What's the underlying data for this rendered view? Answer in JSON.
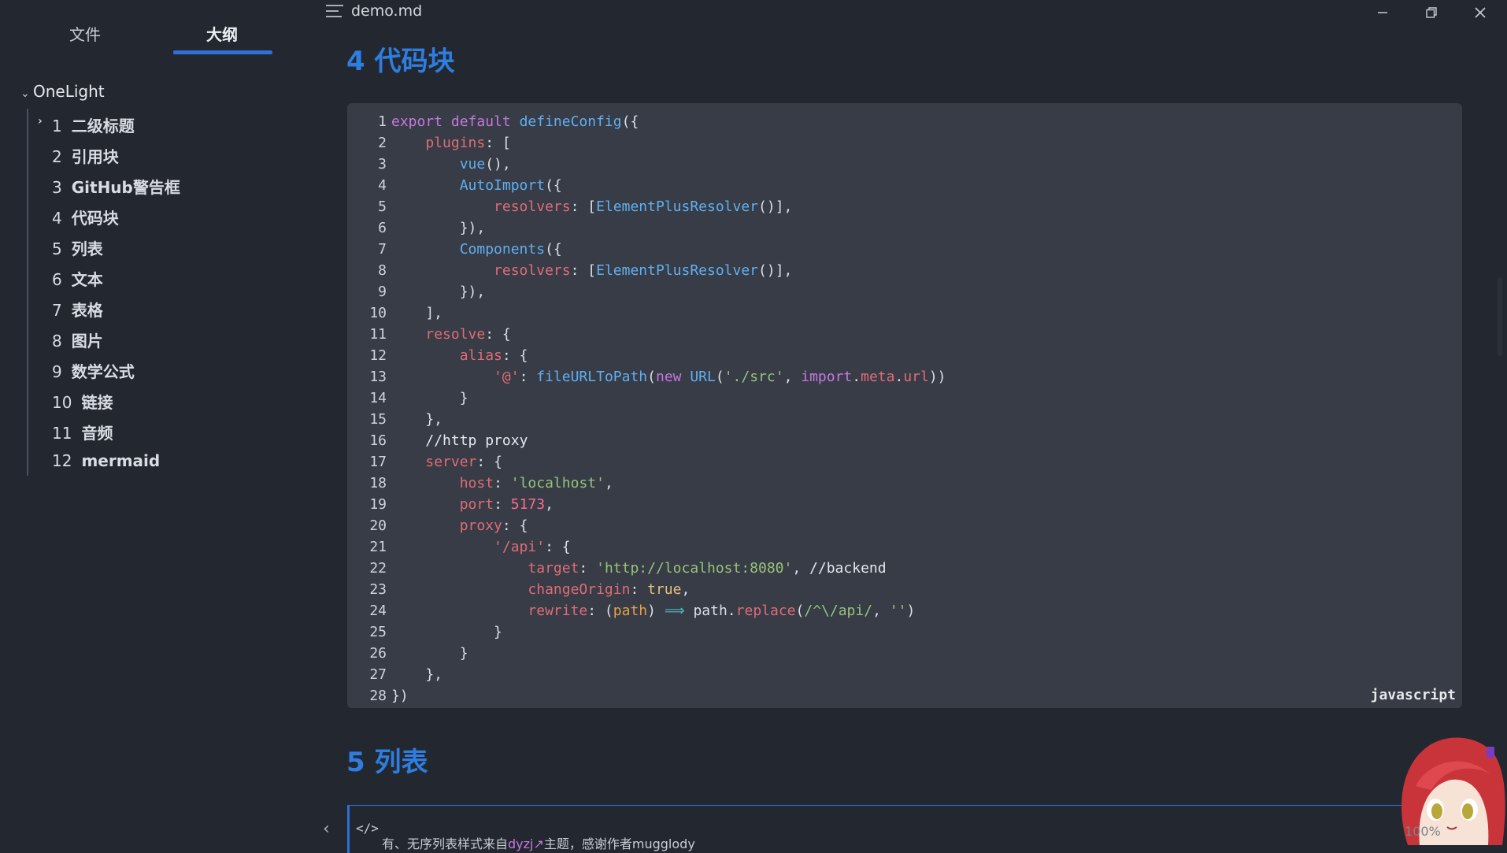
{
  "window": {
    "title": "demo.md"
  },
  "sidebar": {
    "tabs": [
      {
        "label": "文件"
      },
      {
        "label": "大纲"
      }
    ],
    "root": "OneLight",
    "items": [
      {
        "num": "1",
        "label": "二级标题"
      },
      {
        "num": "2",
        "label": "引用块"
      },
      {
        "num": "3",
        "label": "GitHub警告框"
      },
      {
        "num": "4",
        "label": "代码块"
      },
      {
        "num": "5",
        "label": "列表"
      },
      {
        "num": "6",
        "label": "文本"
      },
      {
        "num": "7",
        "label": "表格"
      },
      {
        "num": "8",
        "label": "图片"
      },
      {
        "num": "9",
        "label": "数学公式"
      },
      {
        "num": "10",
        "label": "链接"
      },
      {
        "num": "11",
        "label": "音频"
      },
      {
        "num": "12",
        "label": "mermaid"
      }
    ]
  },
  "main": {
    "heading_code": "4 代码块",
    "heading_list": "5 列表",
    "code_language": "javascript",
    "callout_prefix": "有、无序列表样式来自",
    "callout_link": "dyzj",
    "callout_suffix": "主题，感谢作者mugglody",
    "zoom": "100%"
  },
  "code_lines": [
    [
      [
        "kw",
        "export default "
      ],
      [
        "fn",
        "defineConfig"
      ],
      [
        "p",
        "({"
      ]
    ],
    [
      [
        "p",
        "    "
      ],
      [
        "prop",
        "plugins"
      ],
      [
        "p",
        ": ["
      ]
    ],
    [
      [
        "p",
        "        "
      ],
      [
        "fn",
        "vue"
      ],
      [
        "p",
        "(),"
      ]
    ],
    [
      [
        "p",
        "        "
      ],
      [
        "fn",
        "AutoImport"
      ],
      [
        "p",
        "({"
      ]
    ],
    [
      [
        "p",
        "            "
      ],
      [
        "prop",
        "resolvers"
      ],
      [
        "p",
        ": ["
      ],
      [
        "fn",
        "ElementPlusResolver"
      ],
      [
        "p",
        "()],"
      ]
    ],
    [
      [
        "p",
        "        }),"
      ]
    ],
    [
      [
        "p",
        "        "
      ],
      [
        "fn",
        "Components"
      ],
      [
        "p",
        "({"
      ]
    ],
    [
      [
        "p",
        "            "
      ],
      [
        "prop",
        "resolvers"
      ],
      [
        "p",
        ": ["
      ],
      [
        "fn",
        "ElementPlusResolver"
      ],
      [
        "p",
        "()],"
      ]
    ],
    [
      [
        "p",
        "        }),"
      ]
    ],
    [
      [
        "p",
        "    ],"
      ]
    ],
    [
      [
        "p",
        "    "
      ],
      [
        "prop",
        "resolve"
      ],
      [
        "p",
        ": {"
      ]
    ],
    [
      [
        "p",
        "        "
      ],
      [
        "prop",
        "alias"
      ],
      [
        "p",
        ": {"
      ]
    ],
    [
      [
        "p",
        "            "
      ],
      [
        "prop",
        "'@'"
      ],
      [
        "p",
        ": "
      ],
      [
        "fn",
        "fileURLToPath"
      ],
      [
        "p",
        "("
      ],
      [
        "kw",
        "new "
      ],
      [
        "fn",
        "URL"
      ],
      [
        "p",
        "("
      ],
      [
        "str",
        "'./src'"
      ],
      [
        "p",
        ", "
      ],
      [
        "kw",
        "import"
      ],
      [
        "p",
        "."
      ],
      [
        "prop",
        "meta"
      ],
      [
        "p",
        "."
      ],
      [
        "prop",
        "url"
      ],
      [
        "p",
        "))"
      ]
    ],
    [
      [
        "p",
        "        }"
      ]
    ],
    [
      [
        "p",
        "    },"
      ]
    ],
    [
      [
        "p",
        "    "
      ],
      [
        "cm",
        "//http proxy"
      ]
    ],
    [
      [
        "p",
        "    "
      ],
      [
        "prop",
        "server"
      ],
      [
        "p",
        ": {"
      ]
    ],
    [
      [
        "p",
        "        "
      ],
      [
        "prop",
        "host"
      ],
      [
        "p",
        ": "
      ],
      [
        "str",
        "'localhost'"
      ],
      [
        "p",
        ","
      ]
    ],
    [
      [
        "p",
        "        "
      ],
      [
        "prop",
        "port"
      ],
      [
        "p",
        ": "
      ],
      [
        "num",
        "5173"
      ],
      [
        "p",
        ","
      ]
    ],
    [
      [
        "p",
        "        "
      ],
      [
        "prop",
        "proxy"
      ],
      [
        "p",
        ": {"
      ]
    ],
    [
      [
        "p",
        "            "
      ],
      [
        "prop",
        "'/api'"
      ],
      [
        "p",
        ": {"
      ]
    ],
    [
      [
        "p",
        "                "
      ],
      [
        "prop",
        "target"
      ],
      [
        "p",
        ": "
      ],
      [
        "str",
        "'http://localhost:8080'"
      ],
      [
        "p",
        ", "
      ],
      [
        "cm",
        "//backend"
      ]
    ],
    [
      [
        "p",
        "                "
      ],
      [
        "prop",
        "changeOrigin"
      ],
      [
        "p",
        ": "
      ],
      [
        "bool",
        "true"
      ],
      [
        "p",
        ","
      ]
    ],
    [
      [
        "p",
        "                "
      ],
      [
        "prop",
        "rewrite"
      ],
      [
        "p",
        ": ("
      ],
      [
        "param",
        "path"
      ],
      [
        "p",
        ") "
      ],
      [
        "op",
        "⟹"
      ],
      [
        "p",
        " path."
      ],
      [
        "prop",
        "replace"
      ],
      [
        "p",
        "("
      ],
      [
        "str",
        "/^\\/api/"
      ],
      [
        "p",
        ", "
      ],
      [
        "str",
        "''"
      ],
      [
        "p",
        ")"
      ]
    ],
    [
      [
        "p",
        "            }"
      ]
    ],
    [
      [
        "p",
        "        }"
      ]
    ],
    [
      [
        "p",
        "    },"
      ]
    ],
    [
      [
        "p",
        "})"
      ]
    ]
  ]
}
